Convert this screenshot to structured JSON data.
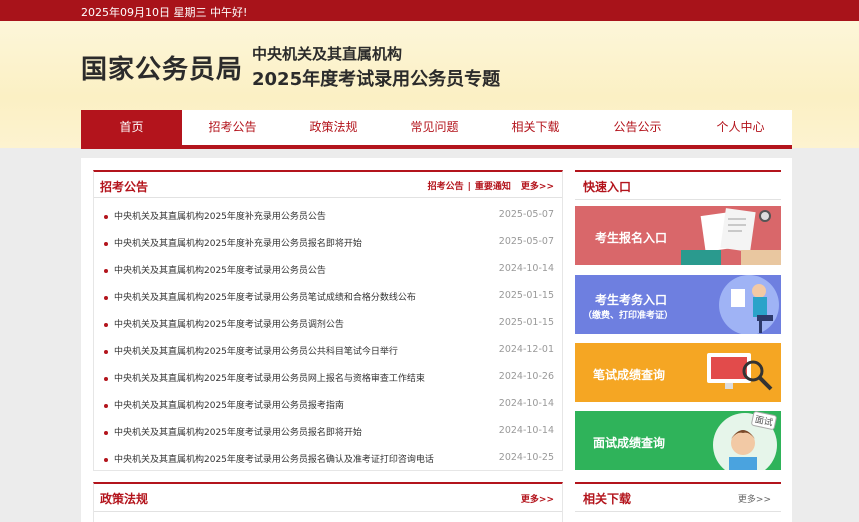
{
  "topbar": {
    "text": "2025年09月10日  星期三   中午好!"
  },
  "header": {
    "site_title": "国家公务员局",
    "subtitle1": "中央机关及其直属机构",
    "subtitle2": "2025年度考试录用公务员专题"
  },
  "nav": {
    "items": [
      {
        "label": "首页"
      },
      {
        "label": "招考公告"
      },
      {
        "label": "政策法规"
      },
      {
        "label": "常见问题"
      },
      {
        "label": "相关下载"
      },
      {
        "label": "公告公示"
      },
      {
        "label": "个人中心"
      }
    ]
  },
  "notices": {
    "title": "招考公告",
    "link1": "招考公告",
    "sep": "|",
    "link2": "重要通知",
    "more": "更多>>",
    "items": [
      {
        "text": "中央机关及其直属机构2025年度补充录用公务员公告",
        "date": "2025-05-07"
      },
      {
        "text": "中央机关及其直属机构2025年度补充录用公务员报名即将开始",
        "date": "2025-05-07"
      },
      {
        "text": "中央机关及其直属机构2025年度考试录用公务员公告",
        "date": "2024-10-14"
      },
      {
        "text": "中央机关及其直属机构2025年度考试录用公务员笔试成绩和合格分数线公布",
        "date": "2025-01-15"
      },
      {
        "text": "中央机关及其直属机构2025年度考试录用公务员调剂公告",
        "date": "2025-01-15"
      },
      {
        "text": "中央机关及其直属机构2025年度考试录用公务员公共科目笔试今日举行",
        "date": "2024-12-01"
      },
      {
        "text": "中央机关及其直属机构2025年度考试录用公务员网上报名与资格审查工作结束",
        "date": "2024-10-26"
      },
      {
        "text": "中央机关及其直属机构2025年度考试录用公务员报考指南",
        "date": "2024-10-14"
      },
      {
        "text": "中央机关及其直属机构2025年度考试录用公务员报名即将开始",
        "date": "2024-10-14"
      },
      {
        "text": "中央机关及其直属机构2025年度考试录用公务员报名确认及准考证打印咨询电话",
        "date": "2024-10-25"
      }
    ]
  },
  "policy": {
    "title": "政策法规",
    "more": "更多>>"
  },
  "quick": {
    "title": "快速入口",
    "tiles": [
      {
        "label": "考生报名入口",
        "color": "#d9676a"
      },
      {
        "label": "考生考务入口",
        "sub": "（缴费、打印准考证）",
        "color": "#6e7fe0"
      },
      {
        "label": "笔试成绩查询",
        "color": "#f5a623"
      },
      {
        "label": "面试成绩查询",
        "color": "#2fb35a",
        "badge": "面试"
      }
    ]
  },
  "downloads": {
    "title": "相关下载",
    "more": "更多>>"
  },
  "colors": {
    "brand": "#b3141c",
    "topbar": "#a8131a"
  }
}
